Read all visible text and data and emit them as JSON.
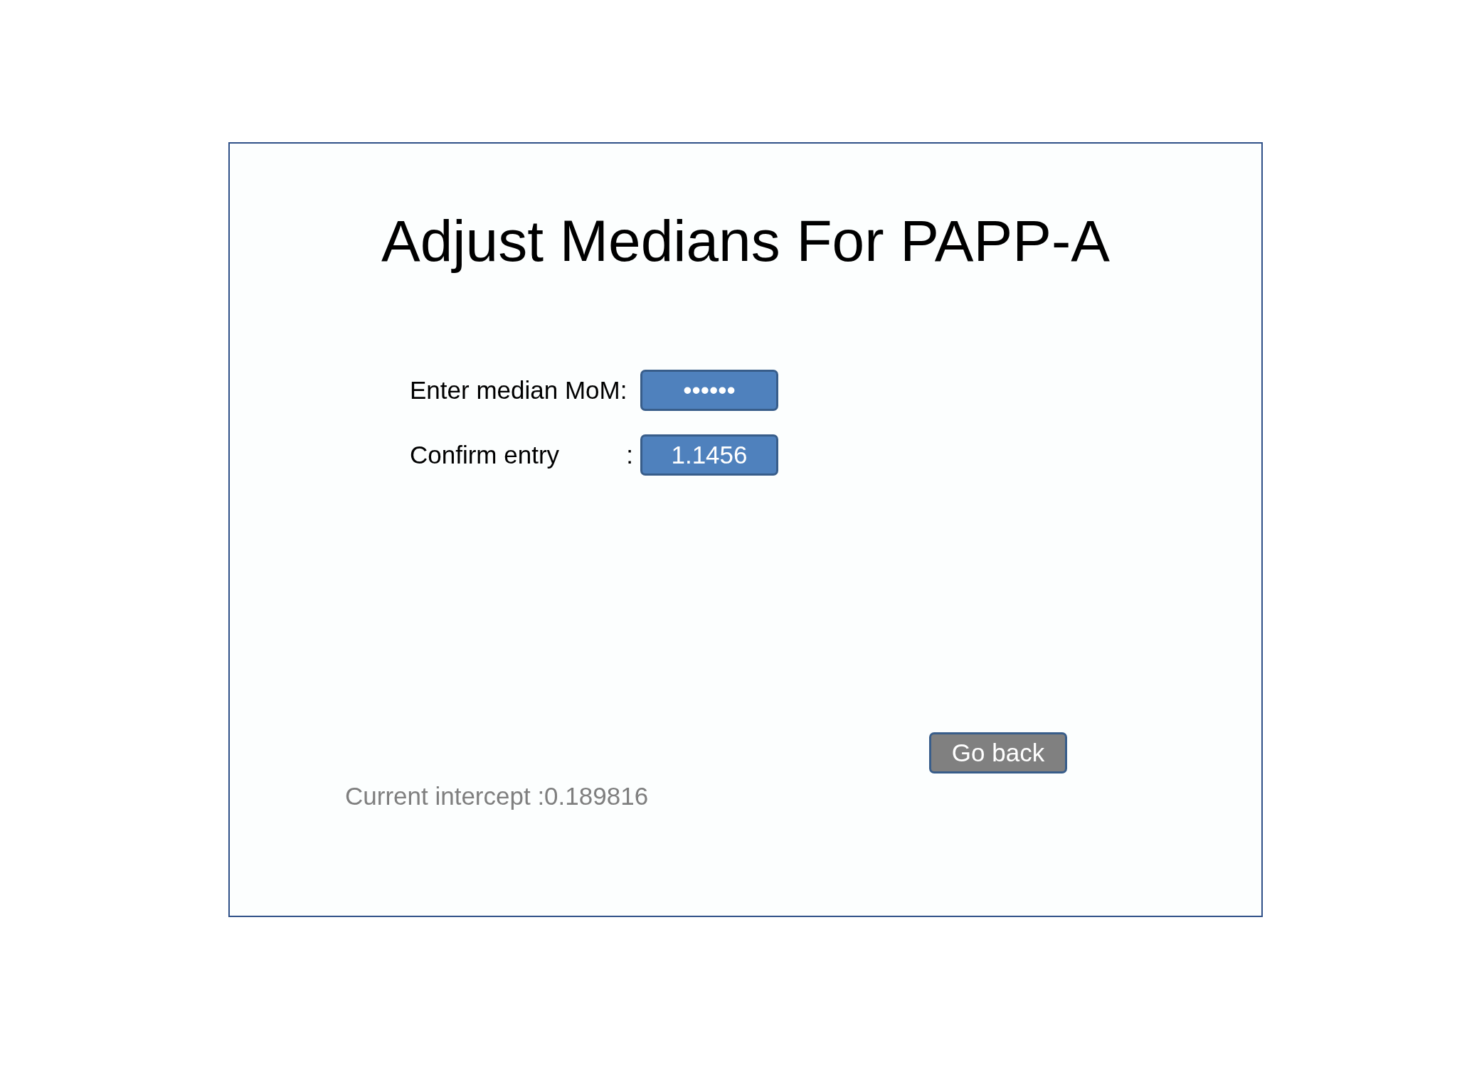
{
  "title": "Adjust Medians For PAPP-A",
  "fields": [
    {
      "label": "Enter median MoM:",
      "value": "••••••"
    },
    {
      "label": "Confirm entry",
      "separator": ":",
      "value": "1.1456"
    }
  ],
  "button": "Go back",
  "status": "Current intercept :0.189816"
}
